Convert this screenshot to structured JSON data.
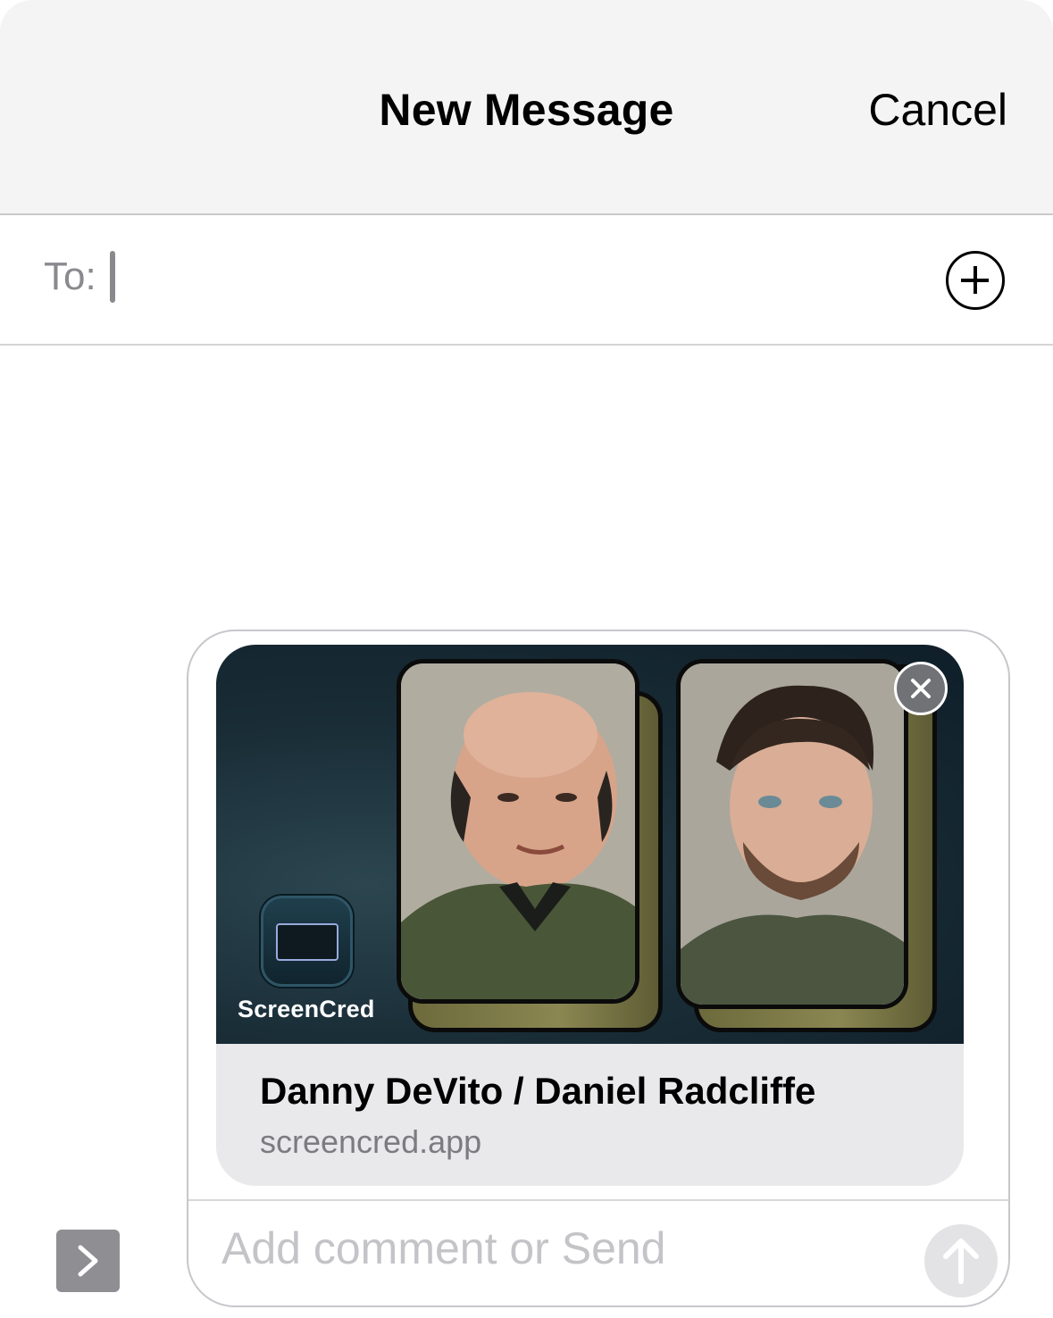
{
  "header": {
    "title": "New Message",
    "cancel_label": "Cancel"
  },
  "recipients": {
    "label": "To:",
    "value": ""
  },
  "link_preview": {
    "app_name": "ScreenCred",
    "title": "Danny DeVito / Daniel Radcliffe",
    "domain": "screencred.app"
  },
  "composer": {
    "placeholder": "Add comment or Send"
  },
  "icons": {
    "add": "plus-circle-icon",
    "expand": "chevron-right-icon",
    "close": "xmark-circle-icon",
    "send": "arrow-up-icon"
  },
  "colors": {
    "header_bg": "#f4f4f4",
    "card_bg": "#e9e9eb",
    "preview_bg": "#1a2e38",
    "send_disabled": "#e3e3e6"
  }
}
